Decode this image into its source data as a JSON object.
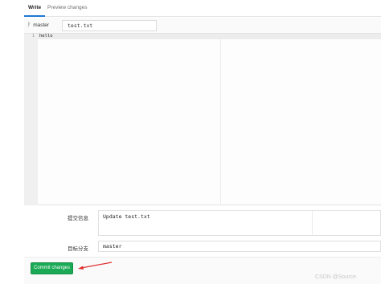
{
  "tabs": {
    "write": "Write",
    "preview": "Preview changes"
  },
  "file": {
    "branch": "master",
    "filename": "test.txt"
  },
  "editor": {
    "line_number": "1",
    "content": "hello"
  },
  "form": {
    "commit_message_label": "提交信息",
    "commit_message_value": "Update test.txt",
    "target_branch_label": "目标分支",
    "target_branch_value": "master"
  },
  "actions": {
    "commit_label": "Commit changes"
  },
  "watermark": "CSDN @Source.",
  "colors": {
    "accent": "#1f78d1",
    "commit_button": "#1aaa55",
    "arrow": "#e03030"
  },
  "icons": {
    "branch": "branch-icon",
    "annotation": "arrow-annotation"
  }
}
